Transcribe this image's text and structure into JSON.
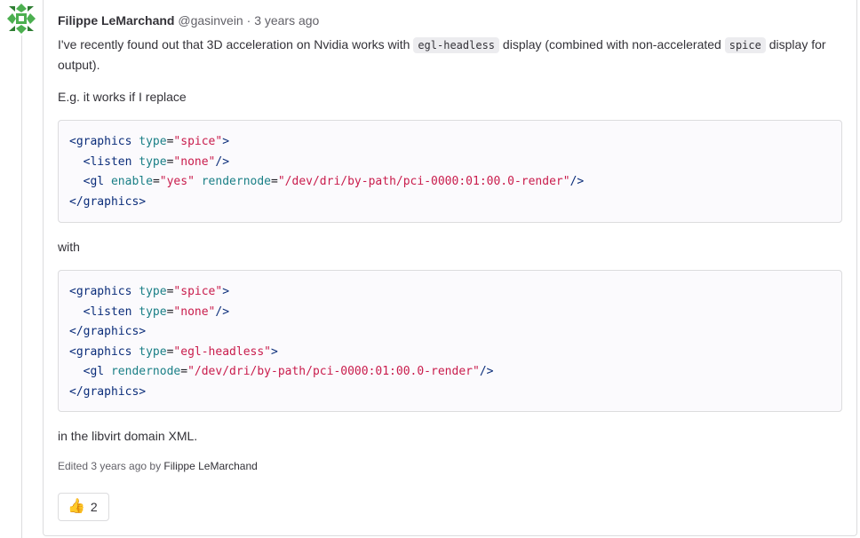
{
  "note": {
    "author_name": "Filippe LeMarchand",
    "author_handle": "@gasinvein",
    "separator": "·",
    "time_ago": "3 years ago",
    "paragraph1": {
      "text_a": "I've recently found out that 3D acceleration on Nvidia works with ",
      "code_a": "egl-headless",
      "text_b": " display (combined with non-accelerated ",
      "code_b": "spice",
      "text_c": " display for output)."
    },
    "paragraph2": "E.g. it works if I replace",
    "paragraph3": "with",
    "paragraph4": "in the libvirt domain XML.",
    "code_block_1": [
      [
        [
          "tag",
          "<graphics"
        ],
        [
          "text",
          " "
        ],
        [
          "attr",
          "type"
        ],
        [
          "punct",
          "="
        ],
        [
          "str",
          "\"spice\""
        ],
        [
          "tag",
          ">"
        ]
      ],
      [
        [
          "text",
          "  "
        ],
        [
          "tag",
          "<listen"
        ],
        [
          "text",
          " "
        ],
        [
          "attr",
          "type"
        ],
        [
          "punct",
          "="
        ],
        [
          "str",
          "\"none\""
        ],
        [
          "tag",
          "/>"
        ]
      ],
      [
        [
          "text",
          "  "
        ],
        [
          "tag",
          "<gl"
        ],
        [
          "text",
          " "
        ],
        [
          "attr",
          "enable"
        ],
        [
          "punct",
          "="
        ],
        [
          "str",
          "\"yes\""
        ],
        [
          "text",
          " "
        ],
        [
          "attr",
          "rendernode"
        ],
        [
          "punct",
          "="
        ],
        [
          "str",
          "\"/dev/dri/by-path/pci-0000:01:00.0-render\""
        ],
        [
          "tag",
          "/>"
        ]
      ],
      [
        [
          "tag",
          "</graphics>"
        ]
      ]
    ],
    "code_block_2": [
      [
        [
          "tag",
          "<graphics"
        ],
        [
          "text",
          " "
        ],
        [
          "attr",
          "type"
        ],
        [
          "punct",
          "="
        ],
        [
          "str",
          "\"spice\""
        ],
        [
          "tag",
          ">"
        ]
      ],
      [
        [
          "text",
          "  "
        ],
        [
          "tag",
          "<listen"
        ],
        [
          "text",
          " "
        ],
        [
          "attr",
          "type"
        ],
        [
          "punct",
          "="
        ],
        [
          "str",
          "\"none\""
        ],
        [
          "tag",
          "/>"
        ]
      ],
      [
        [
          "tag",
          "</graphics>"
        ]
      ],
      [
        [
          "tag",
          "<graphics"
        ],
        [
          "text",
          " "
        ],
        [
          "attr",
          "type"
        ],
        [
          "punct",
          "="
        ],
        [
          "str",
          "\"egl-headless\""
        ],
        [
          "tag",
          ">"
        ]
      ],
      [
        [
          "text",
          "  "
        ],
        [
          "tag",
          "<gl"
        ],
        [
          "text",
          " "
        ],
        [
          "attr",
          "rendernode"
        ],
        [
          "punct",
          "="
        ],
        [
          "str",
          "\"/dev/dri/by-path/pci-0000:01:00.0-render\""
        ],
        [
          "tag",
          "/>"
        ]
      ],
      [
        [
          "tag",
          "</graphics>"
        ]
      ]
    ],
    "edited_prefix": "Edited 3 years ago by",
    "edited_by": "Filippe LeMarchand",
    "award": {
      "icon": "thumbs-up-icon",
      "emoji": "👍",
      "count": "2"
    },
    "avatar_icon": "identicon-avatar",
    "colors": {
      "avatar_green": "#4caf50",
      "avatar_dark": "#2e7d32",
      "code_tag": "#0b2d7a",
      "code_attr": "#1a7f86",
      "code_string": "#c91c4c"
    }
  }
}
